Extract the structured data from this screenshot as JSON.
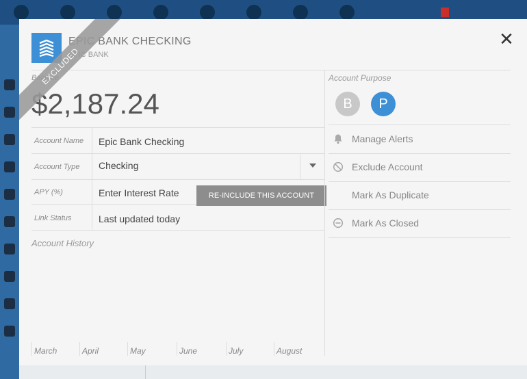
{
  "modal": {
    "title": "EPIC BANK CHECKING",
    "subtitle": "EPIC BANK",
    "excluded_badge": "EXCLUDED",
    "balance_label": "Balance",
    "balance": "$2,187.24",
    "fields": {
      "account_name": {
        "label": "Account Name",
        "value": "Epic Bank Checking"
      },
      "account_type": {
        "label": "Account Type",
        "value": "Checking"
      },
      "apy": {
        "label": "APY (%)",
        "placeholder": "Enter Interest Rate"
      },
      "link_status": {
        "label": "Link Status",
        "value": "Last updated today"
      }
    },
    "reinclude_label": "RE-INCLUDE THIS ACCOUNT",
    "history_label": "Account History",
    "months": [
      "March",
      "April",
      "May",
      "June",
      "July",
      "August"
    ],
    "purpose": {
      "label": "Account Purpose",
      "business": "B",
      "personal": "P"
    },
    "actions": {
      "manage_alerts": "Manage Alerts",
      "exclude_account": "Exclude Account",
      "mark_duplicate": "Mark As Duplicate",
      "mark_closed": "Mark As Closed"
    },
    "colors": {
      "accent": "#3d8fd6",
      "ribbon": "#9a9a9a",
      "button": "#8d8d8d"
    }
  }
}
